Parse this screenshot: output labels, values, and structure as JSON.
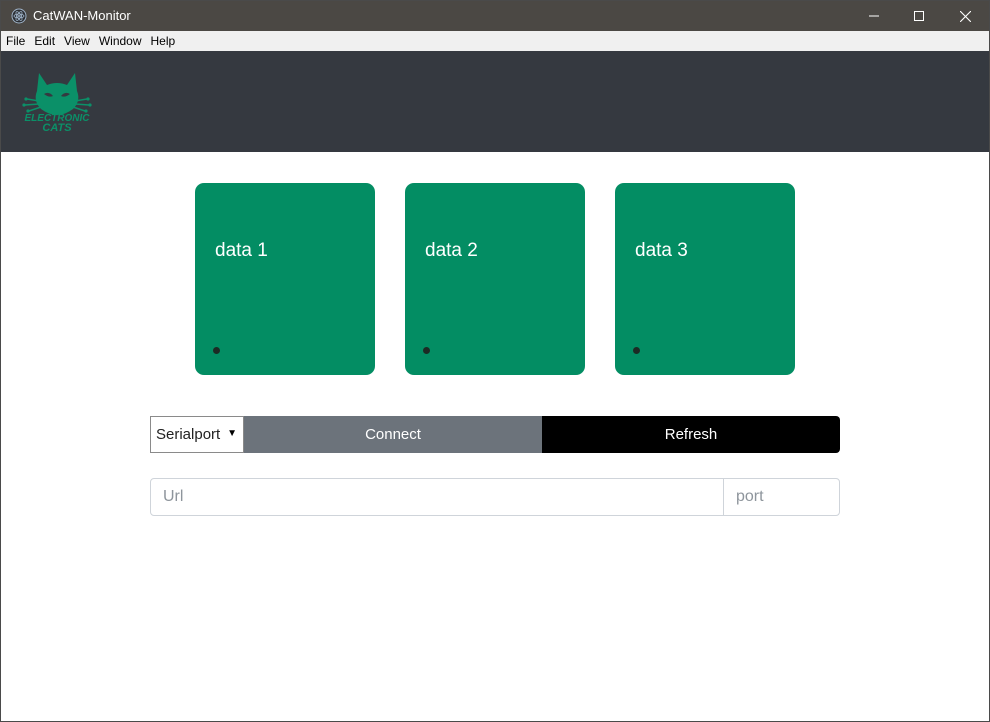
{
  "window": {
    "title": "CatWAN-Monitor"
  },
  "menu": {
    "items": [
      "File",
      "Edit",
      "View",
      "Window",
      "Help"
    ]
  },
  "header": {
    "logo_icon": "electronic-cats-logo",
    "logo_text_1": "ELECTRONIC",
    "logo_text_2": "CATS"
  },
  "cards": [
    {
      "label": "data 1"
    },
    {
      "label": "data 2"
    },
    {
      "label": "data 3"
    }
  ],
  "controls": {
    "port_select_value": "Serialport",
    "connect_label": "Connect",
    "refresh_label": "Refresh"
  },
  "inputs": {
    "url_placeholder": "Url",
    "port_placeholder": "port"
  },
  "colors": {
    "titlebar": "#4b4844",
    "header": "#353940",
    "card": "#038d63",
    "connect": "#6c737b",
    "refresh": "#000000"
  }
}
